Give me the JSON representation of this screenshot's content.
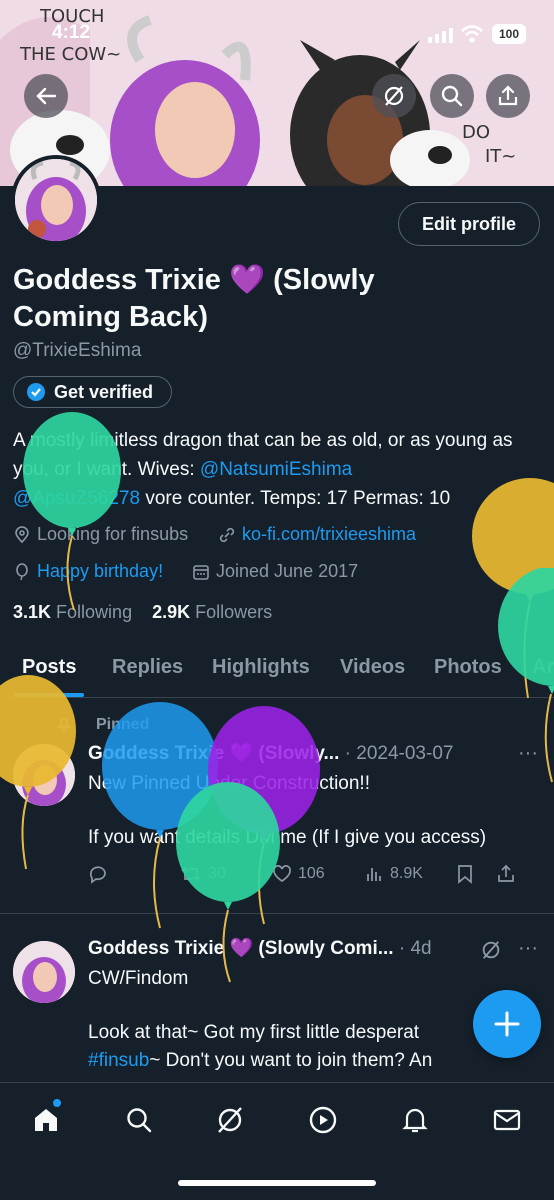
{
  "status_bar": {
    "time": "4:12",
    "battery": "100"
  },
  "banner": {
    "text_left": "TOUCH THE COW~",
    "text_right": "DO IT~"
  },
  "header_actions": {
    "back": "back-arrow",
    "grok": "grok-icon",
    "search": "search-icon",
    "share": "share-icon"
  },
  "profile": {
    "name": "Goddess Trixie 💜 (Slowly Coming Back)",
    "handle": "@TrixieEshima",
    "edit_button": "Edit profile",
    "get_verified": "Get verified",
    "bio_prefix": "A mostly limitless dragon that can be as old, or as young as you, or I want. Wives: ",
    "bio_mention1": "@NatsumiEshima",
    "bio_mention2": "@ApsuZ56278",
    "bio_suffix": " vore counter. Temps: 17 Permas: 10",
    "location": "Looking for finsubs",
    "website": "ko-fi.com/trixieeshima",
    "birthday": "Happy birthday!",
    "joined": "Joined June 2017",
    "following_count": "3.1K",
    "following_label": "Following",
    "followers_count": "2.9K",
    "followers_label": "Followers"
  },
  "tabs": [
    "Posts",
    "Replies",
    "Highlights",
    "Videos",
    "Photos",
    "Ar"
  ],
  "posts": [
    {
      "pinned_label": "Pinned",
      "author": "Goddess Trixie 💜 (Slowly...",
      "date": "· 2024-03-07",
      "line1": "New Pinned Under Construction!!",
      "line2": "If you want details DM me (If I give you access)",
      "replies": "",
      "reposts": "30",
      "likes": "106",
      "views": "8.9K"
    },
    {
      "author": "Goddess Trixie 💜 (Slowly Comi...",
      "date": "· 4d",
      "line1": "CW/Findom",
      "line2_prefix": "Look at that~ Got my first little desperat",
      "hashtag": "#finsub",
      "line2_suffix": "~ Don't you want to join them? An"
    }
  ],
  "colors": {
    "accent": "#1d9bf0",
    "background": "#15202b",
    "muted": "#8b98a5"
  },
  "bottom_nav": [
    "home-icon",
    "search-icon",
    "grok-icon",
    "video-icon",
    "notifications-icon",
    "messages-icon"
  ]
}
